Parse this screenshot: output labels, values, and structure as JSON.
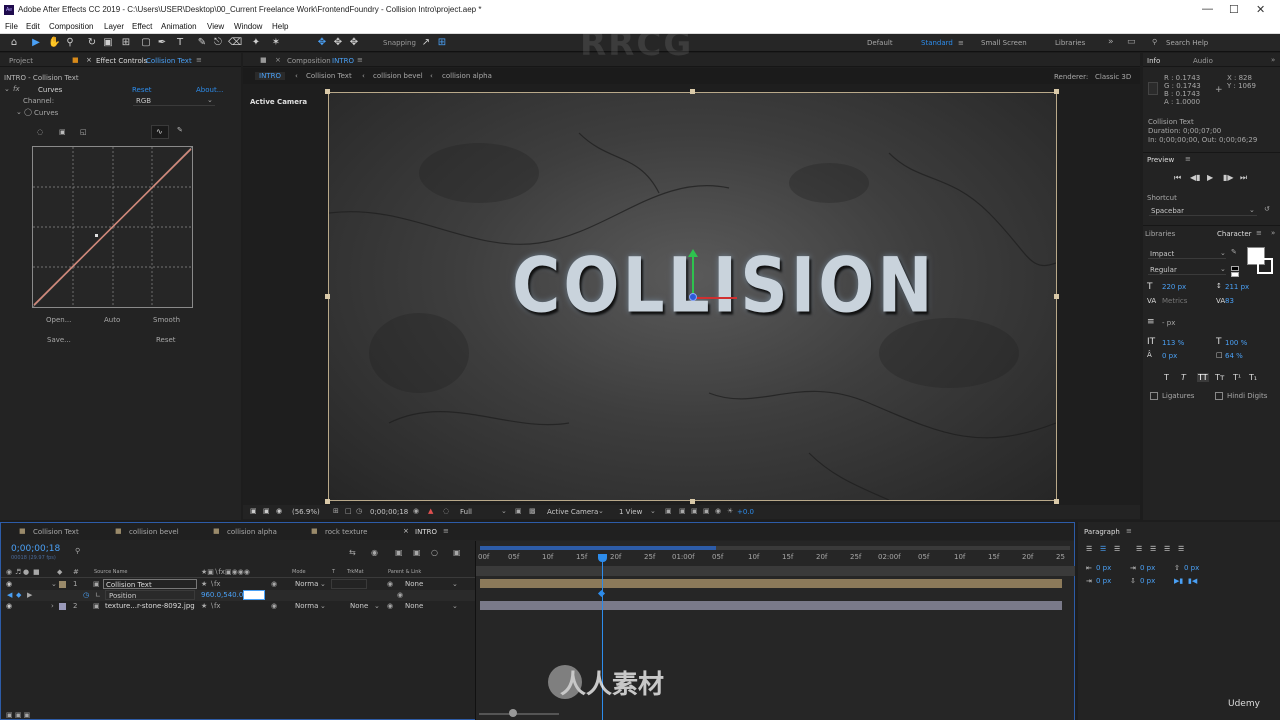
{
  "titlebar": {
    "title": "Adobe After Effects CC 2019 - C:\\Users\\USER\\Desktop\\00_Current Freelance Work\\FrontendFoundry - Collision Intro\\project.aep *",
    "app_icon": "Ae"
  },
  "menu": [
    "File",
    "Edit",
    "Composition",
    "Layer",
    "Effect",
    "Animation",
    "View",
    "Window",
    "Help"
  ],
  "toolbar": {
    "snapping": "Snapping",
    "workspaces": [
      "Default",
      "Standard",
      "Small Screen",
      "Libraries"
    ],
    "search_placeholder": "Search Help"
  },
  "left_panel": {
    "tabs": [
      "Project",
      "Effect Controls",
      "Collision Text"
    ],
    "layer_title": "INTRO - Collision Text",
    "effect_name": "Curves",
    "reset": "Reset",
    "about": "About...",
    "channel_label": "Channel:",
    "channel_value": "RGB",
    "curves_label": "Curves",
    "buttons": [
      "Open...",
      "Auto",
      "Smooth",
      "Save...",
      "Reset"
    ]
  },
  "comp_panel": {
    "tab_prefix": "Composition",
    "tab_name": "INTRO",
    "breadcrumbs": [
      "INTRO",
      "Collision Text",
      "collision bevel",
      "collision alpha"
    ],
    "renderer_label": "Renderer:",
    "renderer_value": "Classic 3D",
    "active_camera": "Active Camera",
    "headline": "COLLISION",
    "zoom": "(56.9%)",
    "timecode": "0;00;00;18",
    "resolution": "Full",
    "camera": "Active Camera",
    "view": "1 View",
    "exposure": "+0.0"
  },
  "right_panel": {
    "info_tabs": [
      "Info",
      "Audio"
    ],
    "r": "R : 0.1743",
    "g": "G : 0.1743",
    "b": "B : 0.1743",
    "a": "A : 1.0000",
    "x": "X : 828",
    "y": "Y : 1069",
    "layer_info": "Collision Text",
    "duration": "Duration: 0;00;07;00",
    "in_out": "In: 0;00;00;00, Out: 0;00;06;29",
    "preview_title": "Preview",
    "shortcut_label": "Shortcut",
    "shortcut_value": "Spacebar",
    "char_tabs": [
      "Libraries",
      "Character"
    ],
    "font": "Impact",
    "style": "Regular",
    "font_size": "220 px",
    "leading": "211 px",
    "kerning": "Metrics",
    "tracking": "83",
    "stroke_width": "- px",
    "vscale": "113 %",
    "hscale": "100 %",
    "baseline": "0 px",
    "tsume": "64 %",
    "ligatures": "Ligatures",
    "hindi": "Hindi Digits",
    "para_title": "Paragraph",
    "para_vals": [
      "0 px",
      "0 px",
      "0 px",
      "0 px",
      "0 px"
    ]
  },
  "timeline": {
    "tabs": [
      "Collision Text",
      "collision bevel",
      "collision alpha",
      "rock texture",
      "INTRO"
    ],
    "timecode": "0;00;00;18",
    "fps": "00018 (29.97 fps)",
    "headers": [
      "Source Name",
      "Mode",
      "T",
      "TrkMat",
      "Parent & Link"
    ],
    "layers": [
      {
        "num": "1",
        "name": "Collision Text",
        "mode": "Norma",
        "trkmat": "",
        "parent": "None"
      },
      {
        "num": "2",
        "name": "texture...r-stone-8092.jpg",
        "mode": "Norma",
        "trkmat": "None",
        "parent": "None"
      }
    ],
    "position_label": "Position",
    "position_value": "960.0,540.0",
    "ruler": [
      "00f",
      "05f",
      "10f",
      "15f",
      "20f",
      "25f",
      "01:00f",
      "05f",
      "10f",
      "15f",
      "20f",
      "25f",
      "02:00f",
      "05f",
      "10f",
      "15f",
      "20f",
      "25"
    ]
  },
  "watermarks": [
    "RRCG",
    "人人素材"
  ],
  "udemy": "Udemy",
  "colors": {
    "accent": "#2d8ceb",
    "layer_tan": "#8c7a5a",
    "layer_gray": "#7a7a8a"
  }
}
